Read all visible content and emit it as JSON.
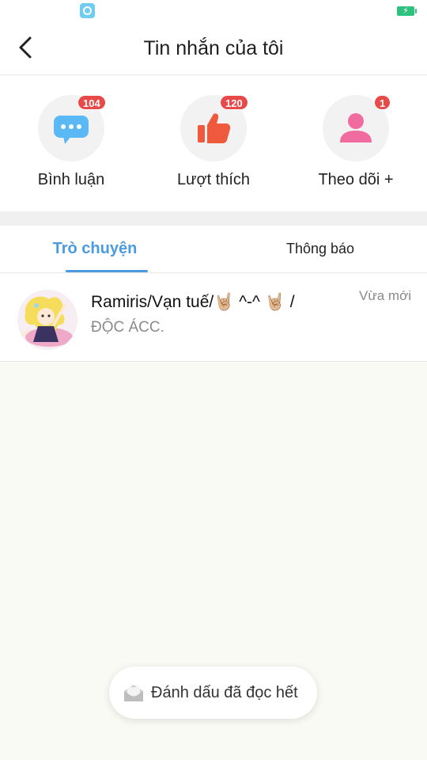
{
  "status_bar": {
    "app_icon": "app-notification-icon",
    "battery_icon": "battery-charging-icon",
    "battery_color": "#2ec27e"
  },
  "header": {
    "title": "Tin nhắn của tôi",
    "back_icon": "chevron-left-icon"
  },
  "quick_actions": [
    {
      "label": "Bình luận",
      "badge": "104",
      "icon": "chat-bubble-icon",
      "color": "#5ab8f5"
    },
    {
      "label": "Lượt thích",
      "badge": "120",
      "icon": "thumbs-up-icon",
      "color": "#f05a3c"
    },
    {
      "label": "Theo dõi +",
      "badge": "1",
      "icon": "person-icon",
      "color": "#f06ca0"
    }
  ],
  "tabs": {
    "chat": "Trò chuyện",
    "notice": "Thông báo",
    "active": "chat",
    "accent": "#4a9be0"
  },
  "conversations": [
    {
      "name": "Ramiris/Vạn tuế/🤘🏼 ^-^ 🤘🏼 /",
      "preview": "ĐỘC ÁCC.",
      "time": "Vừa mới",
      "avatar": "anime-character-avatar"
    }
  ],
  "mark_read": {
    "label": "Đánh dấu đã đọc hết",
    "icon": "open-envelope-icon"
  },
  "colors": {
    "badge": "#e84a4a",
    "background": "#fafaf5"
  }
}
